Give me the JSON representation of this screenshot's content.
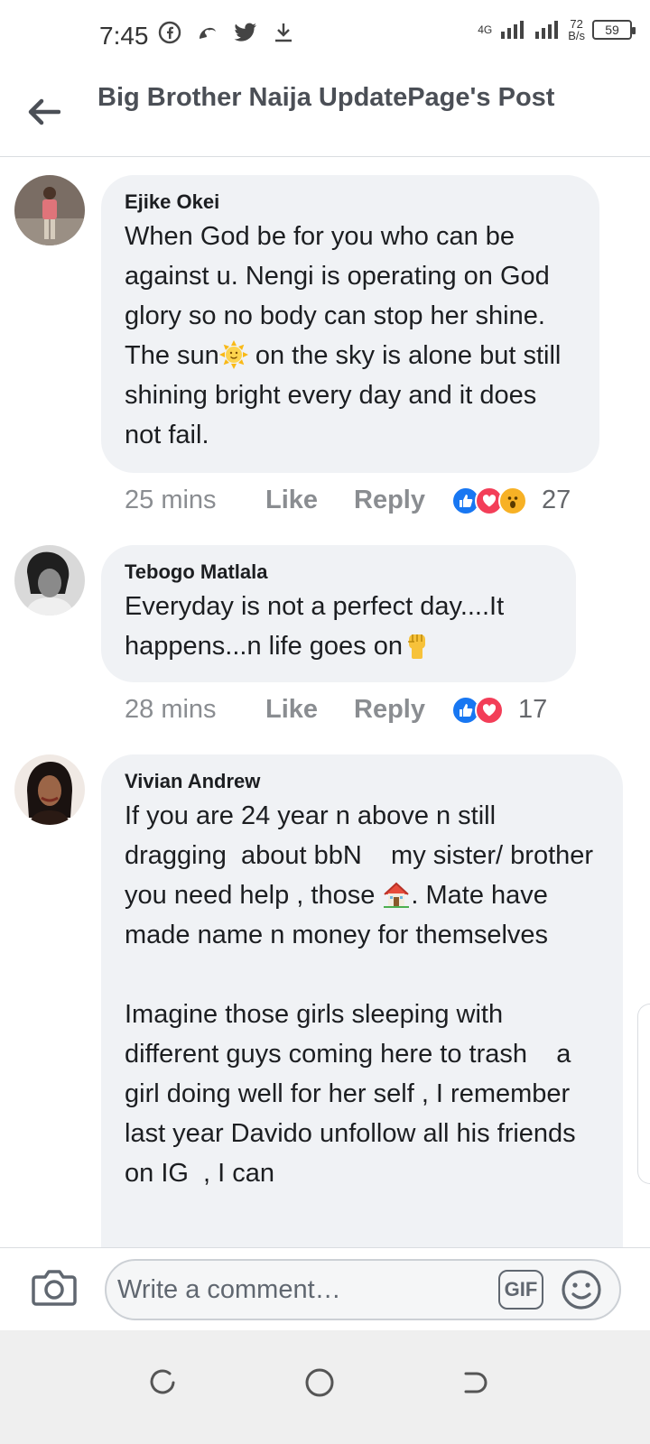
{
  "status_bar": {
    "time": "7:45",
    "network_type": "4G",
    "speed_value": "72",
    "speed_unit": "B/s",
    "battery": "59",
    "icons": [
      "facebook-icon",
      "signal-app-icon",
      "twitter-icon",
      "download-icon"
    ]
  },
  "header": {
    "back_icon": "arrow-left-icon",
    "title": "Big Brother Naija UpdatePage's Post"
  },
  "comments": [
    {
      "author": "Ejike Okei",
      "text_before_emoji": "When God be for you who can be against u. Nengi is operating on God glory so no body can stop her shine. The sun",
      "emoji": "sun-face-emoji",
      "text_after_emoji": " on the sky is alone but still shining bright every day and it does not fail.",
      "time": "25 mins",
      "like_label": "Like",
      "reply_label": "Reply",
      "reactions": [
        "like",
        "love",
        "wow"
      ],
      "reaction_count": "27"
    },
    {
      "author": "Tebogo Matlala",
      "text_before_emoji": "Everyday is not a perfect day....It happens...n life goes on",
      "emoji": "raised-fist-emoji",
      "text_after_emoji": "",
      "time": "28 mins",
      "like_label": "Like",
      "reply_label": "Reply",
      "reactions": [
        "like",
        "love"
      ],
      "reaction_count": "17"
    },
    {
      "author": "Vivian Andrew",
      "text_part1": "If you are 24 year n above n still dragging  about bbN    my sister/ brother you need help , those ",
      "emoji": "house-emoji",
      "text_part2": ". Mate have made name n money for themselves",
      "text_part3": "Imagine those girls sleeping with different guys coming here to trash    a girl doing well for her self , I remember last year Davido unfollow all his friends on IG  , I can"
    }
  ],
  "composer": {
    "placeholder": "Write a comment…",
    "gif_label": "GIF",
    "camera_icon": "camera-icon",
    "sticker_icon": "smiley-icon"
  },
  "colors": {
    "bubble": "#f0f2f5",
    "like_blue": "#1877f2",
    "love_red": "#f33e58",
    "wow_yellow": "#f7b125",
    "meta_gray": "#8a8d91"
  }
}
